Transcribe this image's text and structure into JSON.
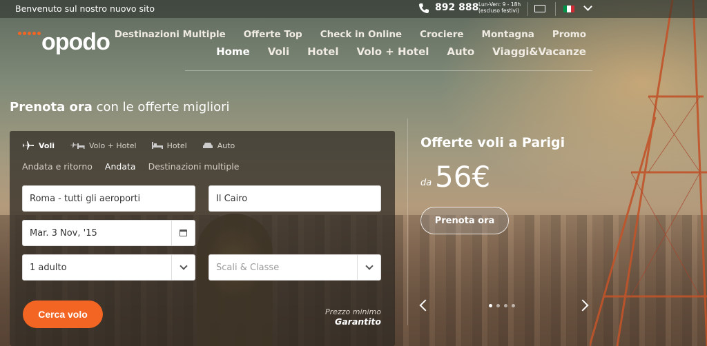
{
  "topbar": {
    "welcome": "Benvenuto sul nostro nuovo sito",
    "phone": "892 888",
    "hours_line1": "Lun-Ven: 9 - 18h",
    "hours_line2": "(escluso festivi)"
  },
  "logo": {
    "text": "opodo"
  },
  "nav": {
    "row1": [
      "Destinazioni Multiple",
      "Offerte Top",
      "Check in Online",
      "Crociere",
      "Montagna",
      "Promo"
    ],
    "row2": [
      "Home",
      "Voli",
      "Hotel",
      "Volo + Hotel",
      "Auto",
      "Viaggi&Vacanze"
    ],
    "active": "Home"
  },
  "headline": {
    "bold": "Prenota ora",
    "rest": " con le offerte migliori"
  },
  "search": {
    "tabs": [
      {
        "label": "Voli",
        "icon": "plane-icon",
        "active": true
      },
      {
        "label": "Volo + Hotel",
        "icon": "plane-bed-icon",
        "active": false
      },
      {
        "label": "Hotel",
        "icon": "bed-icon",
        "active": false
      },
      {
        "label": "Auto",
        "icon": "car-icon",
        "active": false
      }
    ],
    "trip_types": [
      "Andata e ritorno",
      "Andata",
      "Destinazioni multiple"
    ],
    "trip_active": "Andata",
    "from_value": "Roma - tutti gli aeroporti",
    "to_value": "Il Cairo",
    "date_value": "Mar. 3 Nov, '15",
    "passengers_value": "1 adulto",
    "class_placeholder": "Scali & Classe",
    "submit_label": "Cerca volo",
    "guarantee_line1": "Prezzo minimo",
    "guarantee_line2": "Garantito"
  },
  "offer": {
    "title": "Offerte voli a Parigi",
    "from_label": "da",
    "price": "56€",
    "cta": "Prenota ora"
  },
  "colors": {
    "accent": "#f26522"
  }
}
